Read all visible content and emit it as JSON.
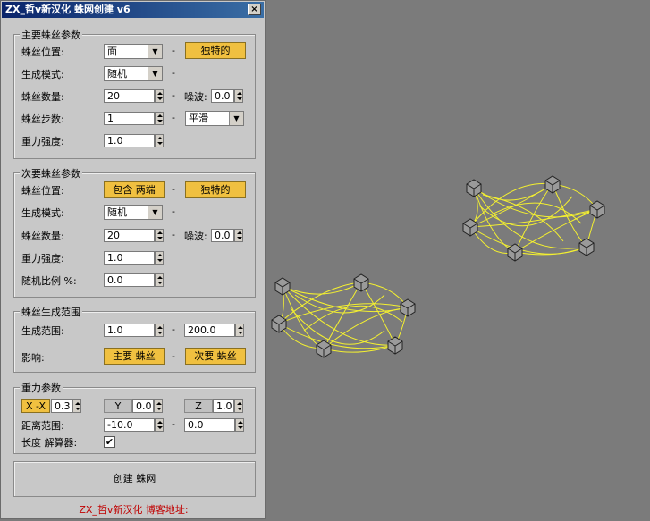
{
  "window": {
    "title": "ZX_哲v新汉化  蛛网创建 v6",
    "close_glyph": "×"
  },
  "primary": {
    "title": "主要蛛丝参数",
    "position_label": "蛛丝位置:",
    "position_value": "面",
    "unique_label": "独特的",
    "mode_label": "生成模式:",
    "mode_value": "随机",
    "count_label": "蛛丝数量:",
    "count_value": "20",
    "noise_label": "噪波:",
    "noise_value": "0.0",
    "steps_label": "蛛丝步数:",
    "steps_value": "1",
    "smooth_value": "平滑",
    "gravity_label": "重力强度:",
    "gravity_value": "1.0"
  },
  "secondary": {
    "title": "次要蛛丝参数",
    "position_label": "蛛丝位置:",
    "position_value": "包含 两端",
    "unique_label": "独特的",
    "mode_label": "生成模式:",
    "mode_value": "随机",
    "count_label": "蛛丝数量:",
    "count_value": "20",
    "noise_label": "噪波:",
    "noise_value": "0.0",
    "gravity_label": "重力强度:",
    "gravity_value": "1.0",
    "ratio_label": "随机比例 %:",
    "ratio_value": "0.0"
  },
  "range": {
    "title": "蛛丝生成范围",
    "range_label": "生成范围:",
    "range_min": "1.0",
    "range_max": "200.0",
    "affect_label": "影响:",
    "affect_primary": "主要 蛛丝",
    "affect_secondary": "次要 蛛丝"
  },
  "gravity": {
    "title": "重力参数",
    "x_label": "X -X",
    "x_value": "0.3",
    "y_label": "Y",
    "y_value": "0.0",
    "z_label": "Z",
    "z_value": "1.0",
    "distance_label": "距离范围:",
    "distance_min": "-10.0",
    "distance_max": "0.0",
    "solver_label": "长度 解算器:",
    "solver_checked": "✔"
  },
  "dash": "-",
  "create_button": "创建 蛛网",
  "footer": "ZX_哲v新汉化 博客地址:",
  "colors": {
    "web": "#f4f030",
    "viewport": "#7b7b7b",
    "accent": "#f0c040"
  }
}
